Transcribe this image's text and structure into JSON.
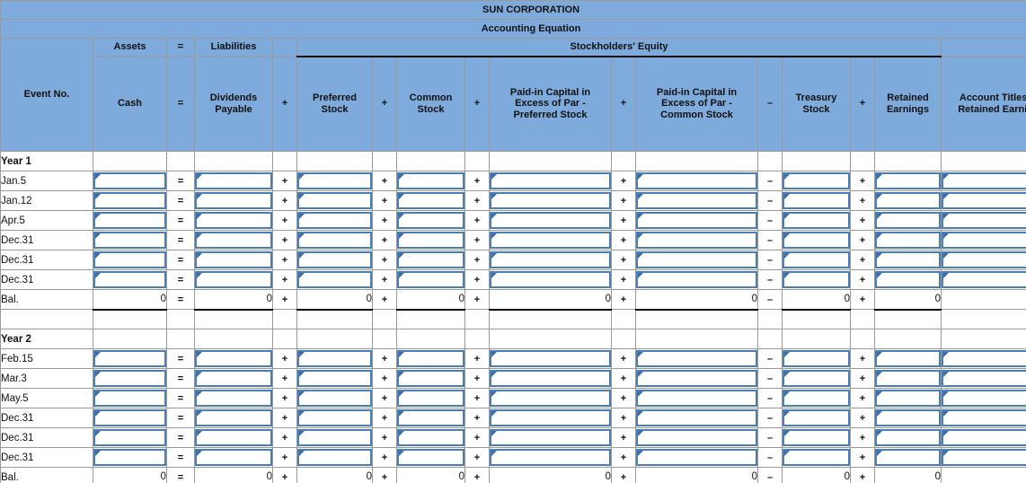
{
  "company": {
    "name": "SUN CORPORATION",
    "subtitle": "Accounting Equation"
  },
  "header": {
    "event_label": "Event No.",
    "groups": {
      "assets": "Assets",
      "eq": "=",
      "liabilities": "Liabilities",
      "plus": "+",
      "stockholders_equity": "Stockholders' Equity",
      "account_titles_group": ""
    },
    "columns": [
      {
        "key": "cash",
        "label": "Cash",
        "op_before": ""
      },
      {
        "key": "op1",
        "label": "=",
        "is_op": true
      },
      {
        "key": "div_payable",
        "label": "Dividends\nPayable",
        "op_before": ""
      },
      {
        "key": "op2",
        "label": "+",
        "is_op": true
      },
      {
        "key": "pref_stock",
        "label": "Preferred\nStock",
        "op_before": ""
      },
      {
        "key": "op3",
        "label": "+",
        "is_op": true
      },
      {
        "key": "common_stock",
        "label": "Common\nStock",
        "op_before": ""
      },
      {
        "key": "op4",
        "label": "+",
        "is_op": true
      },
      {
        "key": "pic_pref",
        "label": "Paid-in Capital in\nExcess of Par -\nPreferred Stock",
        "op_before": ""
      },
      {
        "key": "op5",
        "label": "+",
        "is_op": true
      },
      {
        "key": "pic_common",
        "label": "Paid-in Capital in\nExcess of Par -\nCommon Stock",
        "op_before": ""
      },
      {
        "key": "op6",
        "label": "–",
        "is_op": true
      },
      {
        "key": "treasury",
        "label": "Treasury\nStock",
        "op_before": ""
      },
      {
        "key": "op7",
        "label": "+",
        "is_op": true
      },
      {
        "key": "retained",
        "label": "Retained\nEarnings",
        "op_before": ""
      },
      {
        "key": "acct_titles",
        "label": "Account Titles for\nRetained Earnings",
        "op_before": ""
      }
    ]
  },
  "operators": {
    "equals": "=",
    "plus": "+",
    "minus": "–"
  },
  "sections": [
    {
      "year_label": "Year 1",
      "rows": [
        {
          "label": "Jan.5",
          "type": "input",
          "dropdown": true
        },
        {
          "label": "Jan.12",
          "type": "input",
          "dropdown": false
        },
        {
          "label": "Apr.5",
          "type": "input",
          "dropdown": false
        },
        {
          "label": "Dec.31",
          "type": "input",
          "dropdown": false
        },
        {
          "label": "Dec.31",
          "type": "input",
          "dropdown": false
        },
        {
          "label": "Dec.31",
          "type": "input",
          "dropdown": false
        }
      ],
      "balance": {
        "label": "Bal.",
        "values": {
          "cash": "0",
          "div_payable": "0",
          "pref_stock": "0",
          "common_stock": "0",
          "pic_pref": "0",
          "pic_common": "0",
          "treasury": "0",
          "retained": "0",
          "acct_titles": ""
        }
      }
    },
    {
      "year_label": "Year 2",
      "rows": [
        {
          "label": "Feb.15",
          "type": "input",
          "dropdown": false
        },
        {
          "label": "Mar.3",
          "type": "input",
          "dropdown": false
        },
        {
          "label": "May.5",
          "type": "input",
          "dropdown": false
        },
        {
          "label": "Dec.31",
          "type": "input",
          "dropdown": false
        },
        {
          "label": "Dec.31",
          "type": "input",
          "dropdown": false
        },
        {
          "label": "Dec.31",
          "type": "input",
          "dropdown": false
        }
      ],
      "balance": {
        "label": "Bal.",
        "values": {
          "cash": "0",
          "div_payable": "0",
          "pref_stock": "0",
          "common_stock": "0",
          "pic_pref": "0",
          "pic_common": "0",
          "treasury": "0",
          "retained": "0",
          "acct_titles": ""
        }
      }
    }
  ],
  "colors": {
    "header_blue": "#7FABDC",
    "field_border": "#4A7EB5",
    "field_marker": "#3C6FAA",
    "grid_line": "#9A9A9A",
    "total_rule": "#000000"
  }
}
